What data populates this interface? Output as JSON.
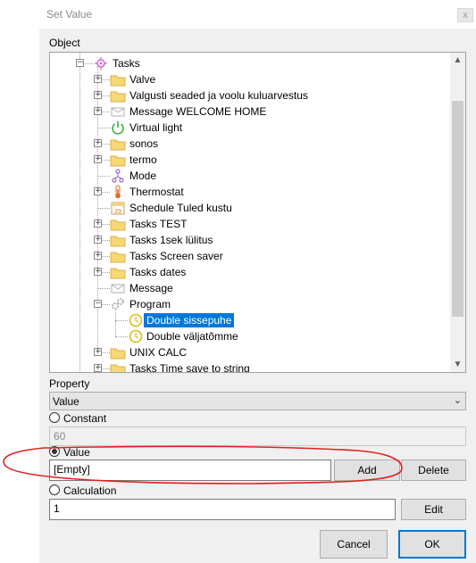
{
  "window": {
    "title": "Set Value",
    "close_glyph": "x"
  },
  "object": {
    "label": "Object",
    "tree": [
      {
        "text": "Tasks",
        "icon": "tasks-icon",
        "expanded": true
      },
      {
        "text": "Valve",
        "icon": "folder-icon"
      },
      {
        "text": "Valgusti seaded ja voolu kuluarvestus",
        "icon": "folder-icon"
      },
      {
        "text": "Message WELCOME HOME",
        "icon": "envelope-icon"
      },
      {
        "text": "Virtual light",
        "icon": "power-icon"
      },
      {
        "text": "sonos",
        "icon": "folder-icon"
      },
      {
        "text": "termo",
        "icon": "folder-icon"
      },
      {
        "text": "Mode",
        "icon": "mode-icon"
      },
      {
        "text": "Thermostat",
        "icon": "thermometer-icon"
      },
      {
        "text": "Schedule Tuled kustu",
        "icon": "calendar-icon",
        "calendar_day": "29"
      },
      {
        "text": "Tasks TEST",
        "icon": "folder-icon"
      },
      {
        "text": "Tasks 1sek lülitus",
        "icon": "folder-icon"
      },
      {
        "text": "Tasks Screen saver",
        "icon": "folder-icon"
      },
      {
        "text": "Tasks dates",
        "icon": "folder-icon"
      },
      {
        "text": "Message",
        "icon": "envelope-icon"
      },
      {
        "text": "Program",
        "icon": "gear-icon",
        "expanded": true
      },
      {
        "text": "Double sissepuhe",
        "icon": "clock-icon",
        "selected": true
      },
      {
        "text": "Double väljatõmme",
        "icon": "clock-icon"
      },
      {
        "text": "UNIX CALC",
        "icon": "folder-icon"
      },
      {
        "text": "Tasks Time save to string",
        "icon": "folder-icon"
      }
    ]
  },
  "property": {
    "label": "Property",
    "selected": "Value"
  },
  "constant": {
    "label": "Constant",
    "value": "60",
    "checked": false
  },
  "value_source": {
    "label": "Value",
    "value": "[Empty]",
    "checked": true,
    "add_label": "Add",
    "delete_label": "Delete"
  },
  "calculation": {
    "label": "Calculation",
    "value": "1",
    "checked": false,
    "edit_label": "Edit"
  },
  "footer": {
    "cancel_label": "Cancel",
    "ok_label": "OK"
  },
  "colors": {
    "selection": "#0078d7",
    "annotation": "#e02020",
    "folder": "#f8d775",
    "folder_edge": "#d9b04a"
  }
}
